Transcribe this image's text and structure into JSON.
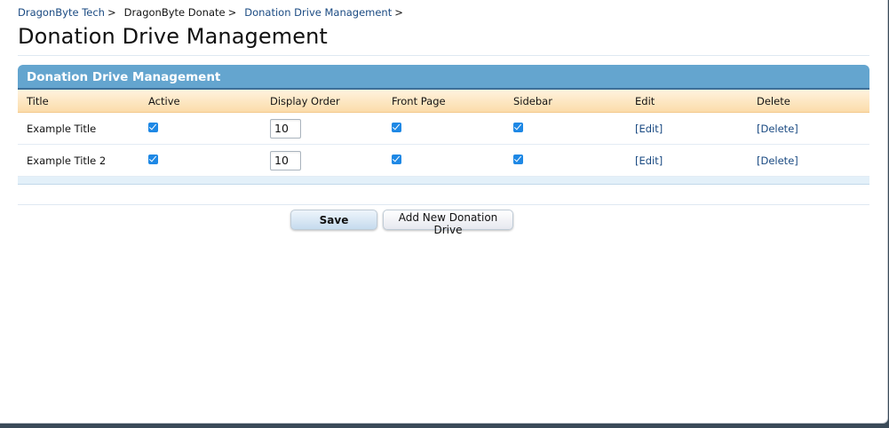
{
  "breadcrumb": {
    "items": [
      {
        "label": "DragonByte Tech",
        "link": true
      },
      {
        "label": "DragonByte Donate",
        "link": false
      },
      {
        "label": "Donation Drive Management",
        "link": true
      }
    ],
    "separator": ">"
  },
  "page": {
    "title": "Donation Drive Management"
  },
  "panel": {
    "title": "Donation Drive Management",
    "columns": [
      "Title",
      "Active",
      "Display Order",
      "Front Page",
      "Sidebar",
      "Edit",
      "Delete"
    ],
    "rows": [
      {
        "title": "Example Title",
        "active": true,
        "display_order": "10",
        "front_page": true,
        "sidebar": true,
        "edit_label": "[Edit]",
        "delete_label": "[Delete]"
      },
      {
        "title": "Example Title 2",
        "active": true,
        "display_order": "10",
        "front_page": true,
        "sidebar": true,
        "edit_label": "[Edit]",
        "delete_label": "[Delete]"
      }
    ]
  },
  "actions": {
    "save_label": "Save",
    "add_label": "Add New Donation Drive"
  },
  "colors": {
    "link": "#1a4a82",
    "panel_header": "#64a5cf",
    "column_header": "#fbdcaa",
    "checkbox": "#1e88e5"
  }
}
